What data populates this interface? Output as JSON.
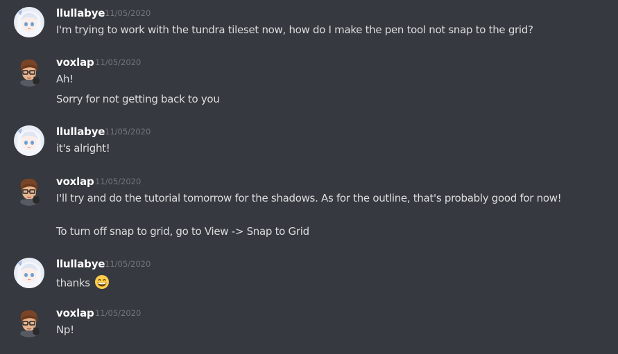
{
  "messages": [
    {
      "author": "llullabye",
      "timestamp": "11/05/2020",
      "lines": [
        "I'm trying to work with the tundra tileset now, how do I make the pen tool not snap to the grid?"
      ]
    },
    {
      "author": "voxlap",
      "timestamp": "11/05/2020",
      "lines": [
        "Ah!",
        "Sorry for not getting back to you"
      ]
    },
    {
      "author": "llullabye",
      "timestamp": "11/05/2020",
      "lines": [
        "it's alright!"
      ]
    },
    {
      "author": "voxlap",
      "timestamp": "11/05/2020",
      "lines": [
        "I'll try and do the tutorial tomorrow for the shadows. As for the outline, that's probably good for now!",
        "To turn off snap to grid, go to View -> Snap to Grid"
      ]
    },
    {
      "author": "llullabye",
      "timestamp": "11/05/2020",
      "lines": [
        "thanks"
      ],
      "emoji": "grinning-smile-emoji"
    },
    {
      "author": "voxlap",
      "timestamp": "11/05/2020",
      "lines": [
        "Np!"
      ]
    }
  ],
  "colors": {
    "background": "#36393f",
    "username": "#ffffff",
    "text": "#dcddde",
    "timestamp": "#72767d"
  }
}
